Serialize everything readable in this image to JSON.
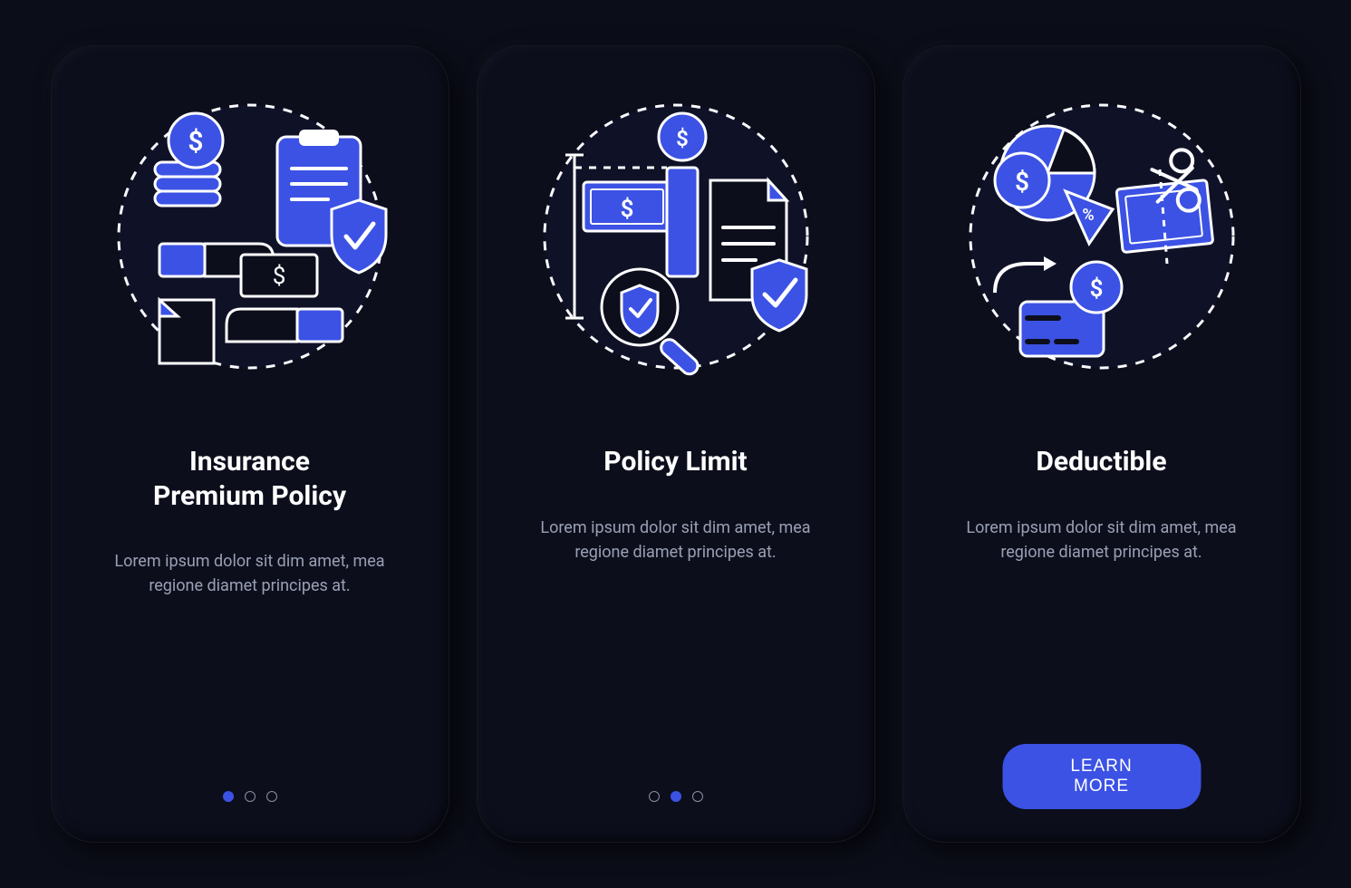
{
  "colors": {
    "accent": "#3c52e4",
    "background": "#0b0d18",
    "card": "#0c0e1c",
    "text": "#ffffff",
    "muted": "#9aa0b4"
  },
  "screens": [
    {
      "title": "Insurance\nPremium Policy",
      "description": "Lorem ipsum dolor sit dim amet, mea regione diamet principes at.",
      "illustration": "insurance-premium",
      "pager": {
        "active": 0,
        "total": 3
      },
      "has_cta": false
    },
    {
      "title": "Policy Limit",
      "description": "Lorem ipsum dolor sit dim amet, mea regione diamet principes at.",
      "illustration": "policy-limit",
      "pager": {
        "active": 1,
        "total": 3
      },
      "has_cta": false
    },
    {
      "title": "Deductible",
      "description": "Lorem ipsum dolor sit dim amet, mea regione diamet principes at.",
      "illustration": "deductible",
      "pager": {
        "active": 2,
        "total": 3
      },
      "has_cta": true,
      "cta_label": "LEARN MORE"
    }
  ]
}
